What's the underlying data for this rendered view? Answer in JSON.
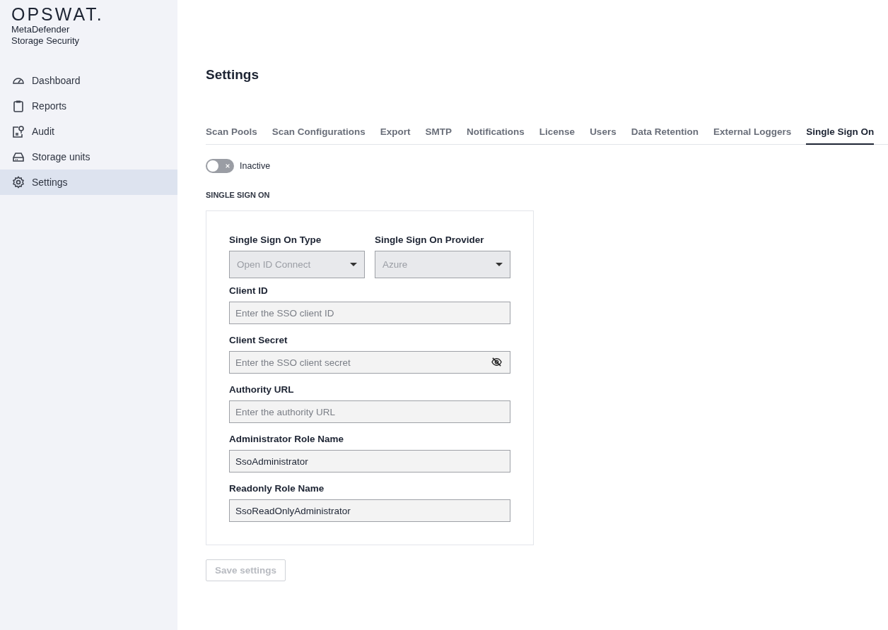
{
  "sidebar": {
    "brand": "OPSWAT.",
    "product": "MetaDefender",
    "product_line": "Storage Security",
    "items": [
      {
        "label": "Dashboard",
        "selected": false
      },
      {
        "label": "Reports",
        "selected": false
      },
      {
        "label": "Audit",
        "selected": false
      },
      {
        "label": "Storage units",
        "selected": false
      },
      {
        "label": "Settings",
        "selected": true
      }
    ]
  },
  "page": {
    "title": "Settings"
  },
  "tabs": [
    {
      "label": "Scan Pools",
      "selected": false
    },
    {
      "label": "Scan Configurations",
      "selected": false
    },
    {
      "label": "Export",
      "selected": false
    },
    {
      "label": "SMTP",
      "selected": false
    },
    {
      "label": "Notifications",
      "selected": false
    },
    {
      "label": "License",
      "selected": false
    },
    {
      "label": "Users",
      "selected": false
    },
    {
      "label": "Data Retention",
      "selected": false
    },
    {
      "label": "External Loggers",
      "selected": false
    },
    {
      "label": "Single Sign On",
      "selected": true
    }
  ],
  "toggle": {
    "label": "Inactive",
    "on": false
  },
  "section": {
    "title": "SINGLE SIGN ON"
  },
  "selects": [
    {
      "label": "Single Sign On Type",
      "value": "Open ID Connect",
      "disabled": true
    },
    {
      "label": "Single Sign On Provider",
      "value": "Azure",
      "disabled": true
    }
  ],
  "fields": [
    {
      "label": "Client ID",
      "kind": "text",
      "placeholder": "Enter the SSO client ID"
    },
    {
      "label": "Client Secret",
      "kind": "secret",
      "placeholder": "Enter the SSO client secret"
    },
    {
      "label": "Authority URL",
      "kind": "text",
      "placeholder": "Enter the authority URL"
    },
    {
      "label": "Administrator Role Name",
      "kind": "text",
      "value": "SsoAdministrator"
    },
    {
      "label": "Readonly Role Name",
      "kind": "text",
      "value": "SsoReadOnlyAdministrator"
    }
  ],
  "save_button": {
    "label": "Save settings",
    "disabled": true
  }
}
